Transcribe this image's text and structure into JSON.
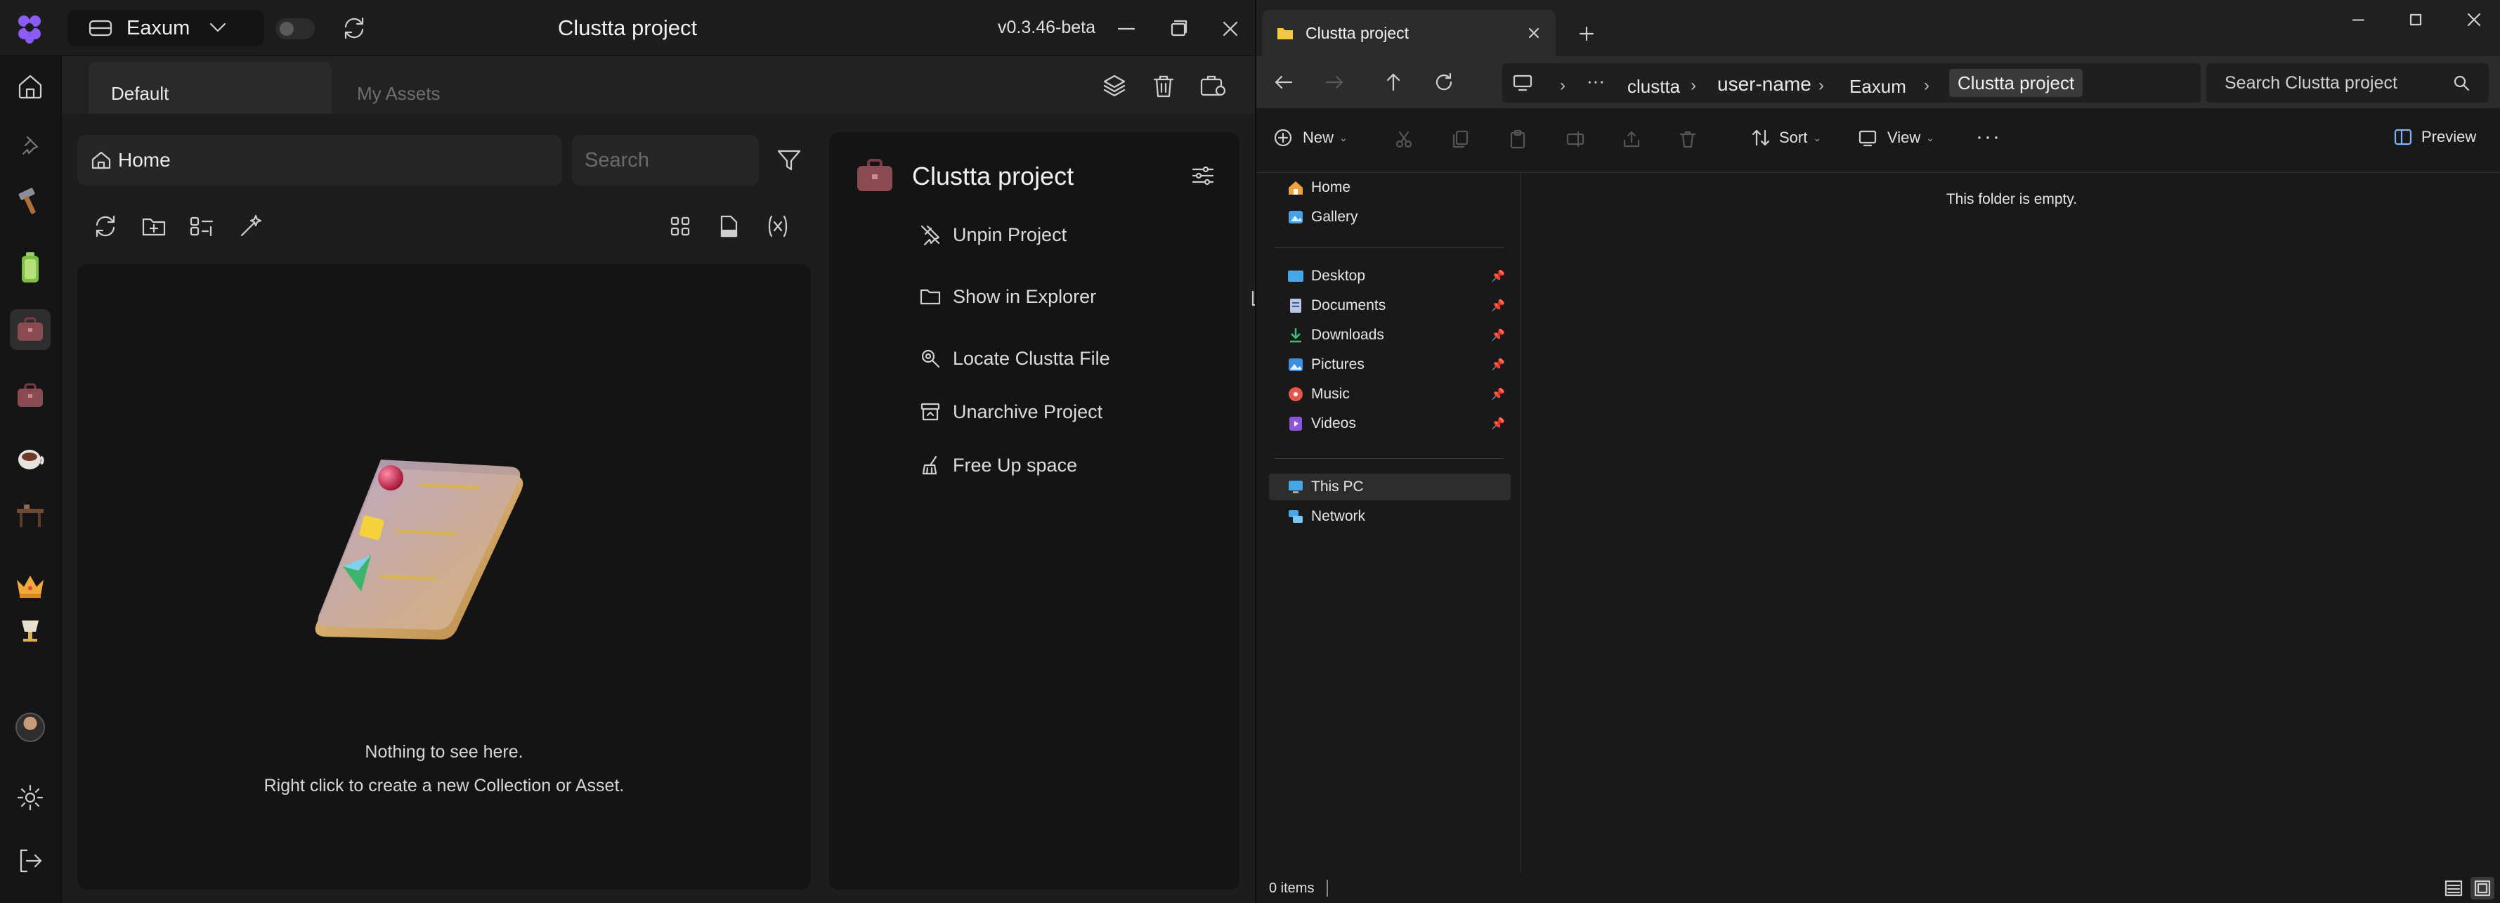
{
  "clustta": {
    "workspace": "Eaxum",
    "title": "Clustta project",
    "version": "v0.3.46-beta",
    "tabs": [
      "Default",
      "My Assets"
    ],
    "breadcrumb": "Home",
    "search_placeholder": "Search",
    "empty_line1": "Nothing to see here.",
    "empty_line2": "Right click to create a new Collection or Asset.",
    "project_panel_title": "Clustta project",
    "menu": [
      "Unpin Project",
      "Show in Explorer",
      "Locate Clustta File",
      "Unarchive Project",
      "Free Up space"
    ],
    "colors": {
      "accent": "#8b5cf6",
      "project_icon": "#8a4a52"
    }
  },
  "explorer": {
    "tab_title": "Clustta project",
    "breadcrumb": [
      "clustta",
      "user-name",
      "Eaxum",
      "Clustta project"
    ],
    "search_placeholder": "Search Clustta project",
    "commands": {
      "new": "New",
      "sort": "Sort",
      "view": "View",
      "preview": "Preview"
    },
    "nav": {
      "top": [
        "Home",
        "Gallery"
      ],
      "pinned": [
        "Desktop",
        "Documents",
        "Downloads",
        "Pictures",
        "Music",
        "Videos"
      ],
      "bottom": [
        "This PC",
        "Network"
      ]
    },
    "empty_text": "This folder is empty.",
    "status": "0 items"
  }
}
